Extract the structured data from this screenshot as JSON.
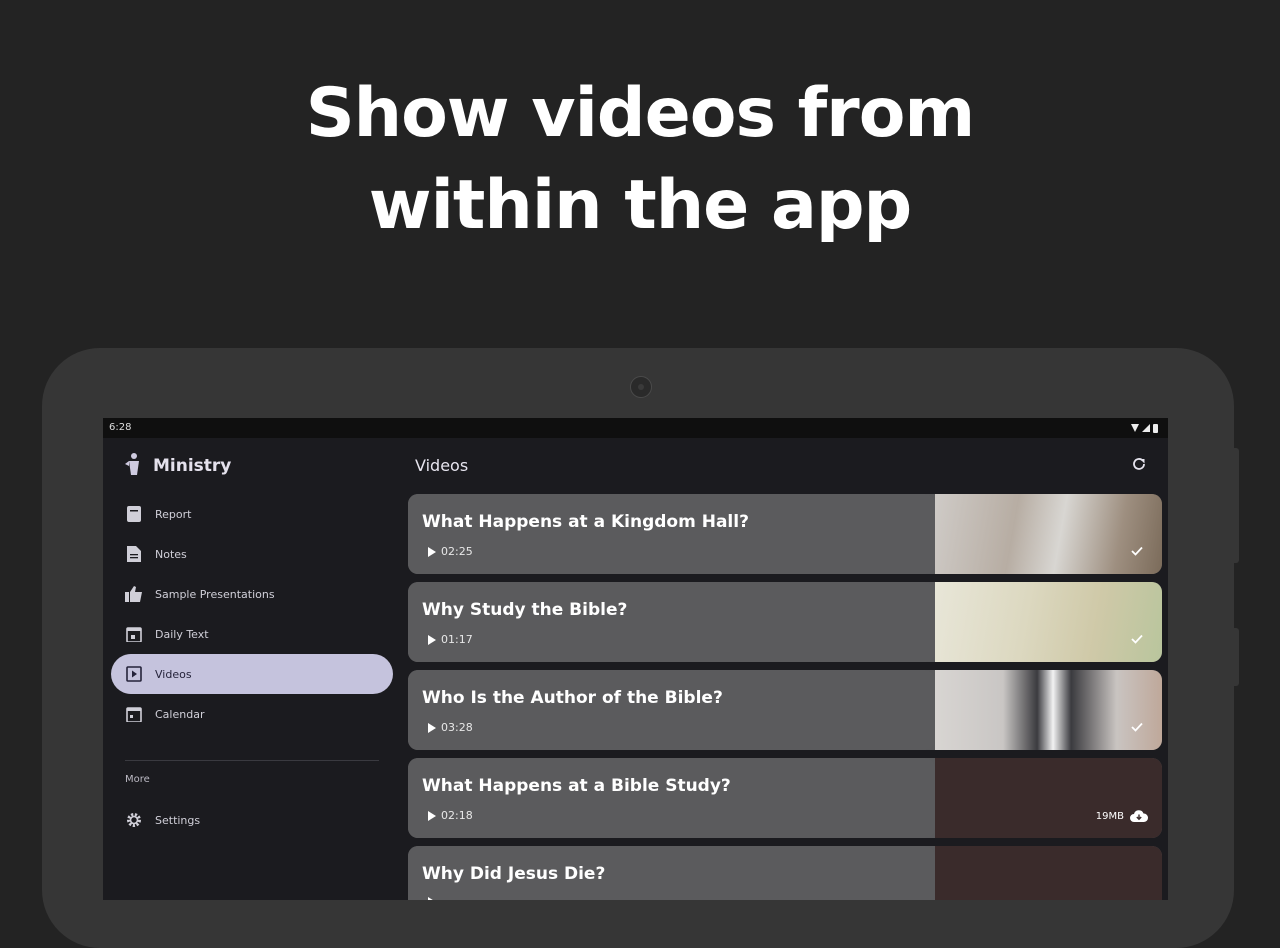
{
  "headline": {
    "line1": "Show videos from",
    "line2": "within the app"
  },
  "status_bar": {
    "time": "6:28"
  },
  "drawer": {
    "brand": "Ministry",
    "items": [
      {
        "label": "Report",
        "icon": "report-icon"
      },
      {
        "label": "Notes",
        "icon": "notes-icon"
      },
      {
        "label": "Sample Presentations",
        "icon": "thumbs-up-icon"
      },
      {
        "label": "Daily Text",
        "icon": "calendar-day-icon"
      },
      {
        "label": "Videos",
        "icon": "video-icon",
        "active": true
      },
      {
        "label": "Calendar",
        "icon": "calendar-icon"
      }
    ],
    "section_label": "More",
    "settings_label": "Settings"
  },
  "main": {
    "title": "Videos",
    "videos": [
      {
        "title": "What Happens at a Kingdom Hall?",
        "duration": "02:25",
        "status": "downloaded"
      },
      {
        "title": "Why Study the Bible?",
        "duration": "01:17",
        "status": "downloaded"
      },
      {
        "title": "Who Is the Author of the Bible?",
        "duration": "03:28",
        "status": "downloaded"
      },
      {
        "title": "What Happens at a Bible Study?",
        "duration": "02:18",
        "size": "19MB",
        "status": "download"
      },
      {
        "title": "Why Did Jesus Die?",
        "duration": "",
        "status": "download"
      }
    ]
  },
  "colors": {
    "background": "#232323",
    "active_nav": "#c5c3dd",
    "card": "#5b5b5d"
  }
}
